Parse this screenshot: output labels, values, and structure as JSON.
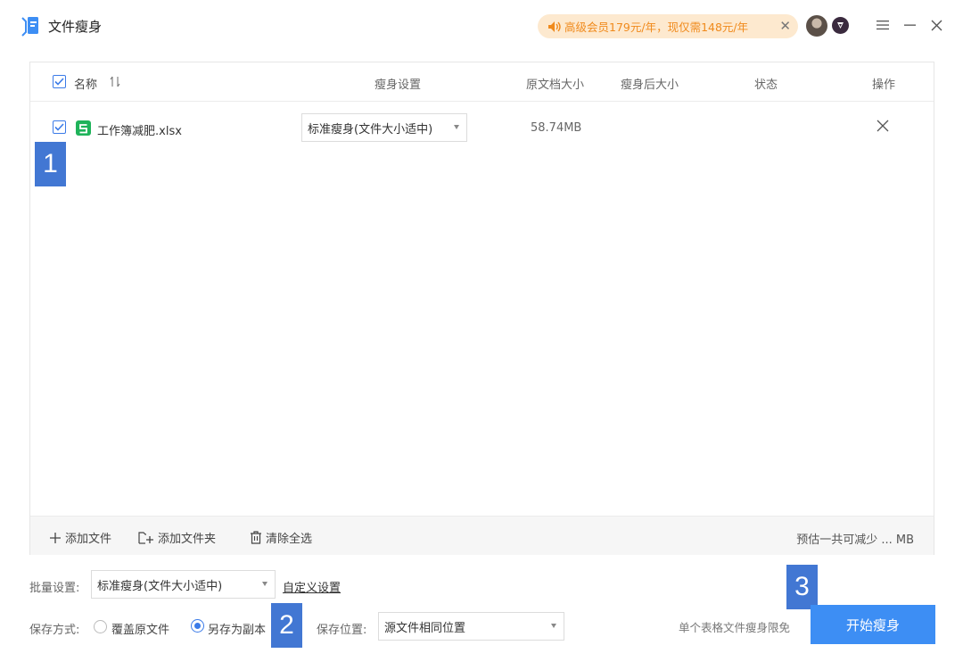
{
  "app": {
    "title": "文件瘦身",
    "logo_icon": "file-slim-logo-icon"
  },
  "promo": {
    "text": "高级会员179元/年，现仅需148元/年",
    "icon": "speaker-icon",
    "accent": "#f08a1c",
    "background": "#fde9cf"
  },
  "window_controls": {
    "menu": "hamburger-menu-icon",
    "minimize": "minimize-icon",
    "close": "close-icon"
  },
  "table": {
    "columns": {
      "name": "名称",
      "sort_icon": "sort-icon",
      "slim_setting": "瘦身设置",
      "original_size": "原文档大小",
      "slimmed_size": "瘦身后大小",
      "status": "状态",
      "action": "操作"
    },
    "rows": [
      {
        "checked": true,
        "file_name": "工作簿减肥.xlsx",
        "file_icon": "spreadsheet-file-icon",
        "slim_setting": "标准瘦身(文件大小适中)",
        "original_size": "58.74MB",
        "slimmed_size": "",
        "status": ""
      }
    ]
  },
  "badges": {
    "one": "1",
    "two": "2",
    "three": "3"
  },
  "toolbar": {
    "add_file": "添加文件",
    "add_folder": "添加文件夹",
    "clear_all": "清除全选",
    "estimate": "预估一共可减少 ... MB"
  },
  "batch": {
    "label": "批量设置:",
    "value": "标准瘦身(文件大小适中)",
    "custom_link": "自定义设置"
  },
  "save": {
    "label": "保存方式:",
    "options": [
      {
        "label": "覆盖原文件",
        "checked": false
      },
      {
        "label": "另存为副本",
        "checked": true
      }
    ],
    "location_label": "保存位置:",
    "location_value": "源文件相同位置"
  },
  "footer": {
    "limit_note": "单个表格文件瘦身限免",
    "start_button": "开始瘦身",
    "primary_color": "#3d8ef4"
  }
}
